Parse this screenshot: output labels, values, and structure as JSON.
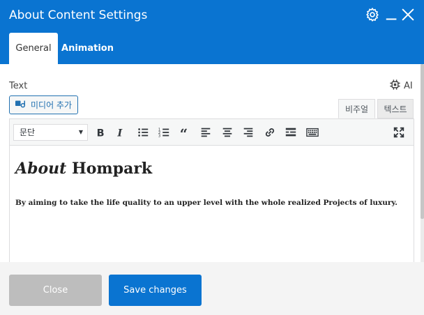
{
  "header": {
    "title": "About Content Settings",
    "tabs": [
      {
        "label": "General",
        "active": true
      },
      {
        "label": "Animation",
        "active": false
      }
    ],
    "icons": [
      "gear-icon",
      "minimize-icon",
      "close-icon"
    ]
  },
  "field": {
    "label": "Text",
    "ai_label": "AI"
  },
  "editor": {
    "add_media_label": "미디어 추가",
    "mode_tabs": [
      "비주얼",
      "텍스트"
    ],
    "active_mode": "비주얼",
    "format_value": "문단",
    "toolbar_icons": [
      "bold-icon",
      "italic-icon",
      "bulleted-list-icon",
      "numbered-list-icon",
      "blockquote-icon",
      "align-left-icon",
      "align-center-icon",
      "align-right-icon",
      "link-icon",
      "read-more-icon",
      "toolbar-toggle-icon",
      "fullscreen-icon"
    ],
    "content": {
      "heading_italic": "About",
      "heading_rest": " Hompark",
      "paragraph": "By aiming to take the life quality to an upper level with the whole realized Projects of luxury."
    }
  },
  "footer": {
    "close_label": "Close",
    "save_label": "Save changes"
  },
  "colors": {
    "accent": "#0a74d1",
    "close_button": "#bdbdbd",
    "footer_bg": "#f4f4f4"
  }
}
